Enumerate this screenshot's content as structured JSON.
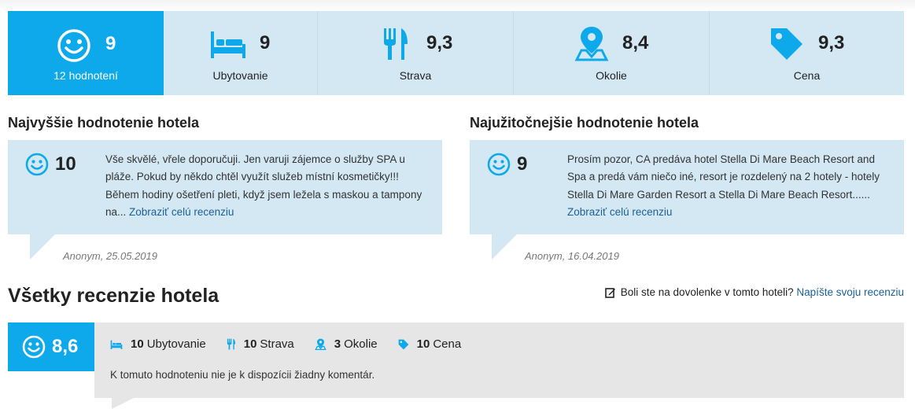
{
  "score_bar": {
    "main": {
      "value": "9",
      "label": "12 hodnotení"
    },
    "categories": [
      {
        "value": "9",
        "label": "Ubytovanie",
        "icon": "bed-icon"
      },
      {
        "value": "9,3",
        "label": "Strava",
        "icon": "fork-knife-icon"
      },
      {
        "value": "8,4",
        "label": "Okolie",
        "icon": "map-pin-icon"
      },
      {
        "value": "9,3",
        "label": "Cena",
        "icon": "price-tag-icon"
      }
    ]
  },
  "highest": {
    "title": "Najvyššie hodnotenie hotela",
    "score": "10",
    "text": "Vše skvělé, vřele doporučuji. Jen varuji zájemce o služby SPA u pláže. Pokud by někdo chtěl využít služeb místní kosmetičky!!! Během hodiny ošetření pleti, když jsem ležela s maskou a tampony na...",
    "link": "Zobraziť celú recenziu",
    "meta": "Anonym, 25.05.2019"
  },
  "most_useful": {
    "title": "Najužitočnejšie hodnotenie hotela",
    "score": "9",
    "text": "Prosím pozor, CA predáva hotel Stella Di Mare Beach Resort and Spa a predá vám niečo iné, resort je rozdelený na 2 hotely - hotely Stella Di Mare Garden Resort a Stella Di Mare Beach Resort......",
    "link": "Zobraziť celú recenziu",
    "meta": "Anonym, 16.04.2019"
  },
  "all_reviews": {
    "title": "Všetky recenzie hotela",
    "prompt": "Boli ste na dovolenke v tomto hoteli?",
    "write_link": "Napíšte svoju recenziu",
    "review": {
      "score": "8,6",
      "cats": [
        {
          "value": "10",
          "label": "Ubytovanie"
        },
        {
          "value": "10",
          "label": "Strava"
        },
        {
          "value": "3",
          "label": "Okolie"
        },
        {
          "value": "10",
          "label": "Cena"
        }
      ],
      "comment": "K tomuto hodnoteniu nie je k dispozícii žiadny komentár."
    }
  },
  "colors": {
    "accent": "#0ea9ea",
    "panel": "#d3e8f3",
    "link": "#1a5f95",
    "grey": "#e6e6e6"
  }
}
